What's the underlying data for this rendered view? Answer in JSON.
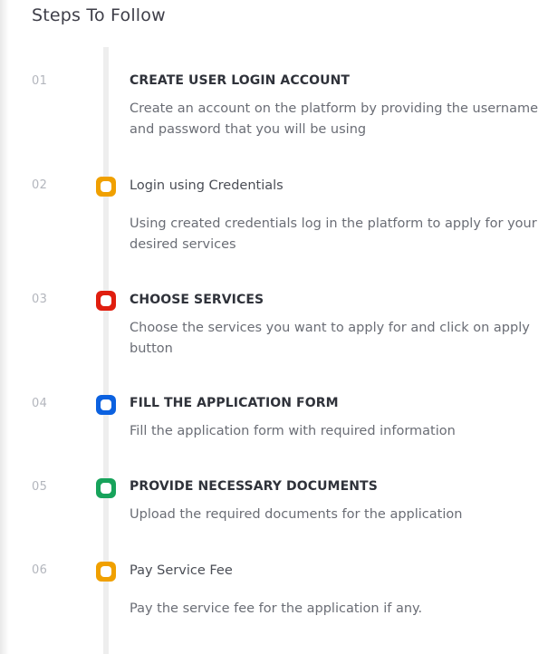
{
  "title": "Steps To Follow",
  "colors": {
    "amber": "#f0a000",
    "red": "#e01e0f",
    "blue": "#0b61e0",
    "green": "#17a35b",
    "timeline": "#eeeeee"
  },
  "steps": [
    {
      "number": "01",
      "title": "CREATE USER LOGIN ACCOUNT",
      "description": "Create an account on the platform by providing the username and password that you will be using",
      "marker_color": ""
    },
    {
      "number": "02",
      "title": "Login using Credentials",
      "description": "Using created credentials log in the platform to apply for your desired services",
      "marker_color": "amber"
    },
    {
      "number": "03",
      "title": "CHOOSE SERVICES",
      "description": "Choose the services you want to apply for and click on apply button",
      "marker_color": "red"
    },
    {
      "number": "04",
      "title": "FILL THE APPLICATION FORM",
      "description": "Fill the application form with required information",
      "marker_color": "blue"
    },
    {
      "number": "05",
      "title": "PROVIDE NECESSARY DOCUMENTS",
      "description": "Upload the required documents for the application",
      "marker_color": "green"
    },
    {
      "number": "06",
      "title": "Pay Service Fee",
      "description": "Pay the service fee for the application if any.",
      "marker_color": "amber"
    }
  ]
}
